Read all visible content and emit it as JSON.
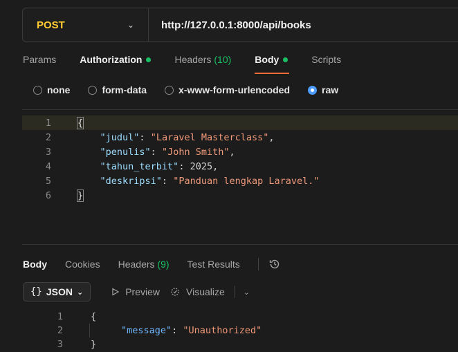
{
  "request": {
    "method": "POST",
    "url": "http://127.0.0.1:8000/api/books"
  },
  "request_tabs": [
    {
      "label": "Params"
    },
    {
      "label": "Authorization",
      "dot": true
    },
    {
      "label": "Headers",
      "count": "(10)"
    },
    {
      "label": "Body",
      "dot": true,
      "active": true
    },
    {
      "label": "Scripts"
    }
  ],
  "body_types": [
    {
      "label": "none",
      "checked": false
    },
    {
      "label": "form-data",
      "checked": false
    },
    {
      "label": "x-www-form-urlencoded",
      "checked": false
    },
    {
      "label": "raw",
      "checked": true
    }
  ],
  "editor": {
    "lines": [
      {
        "n": "1",
        "open": "{"
      },
      {
        "n": "2",
        "key": "\"judul\"",
        "value": "\"Laravel Masterclass\"",
        "trail": ","
      },
      {
        "n": "3",
        "key": "\"penulis\"",
        "value": "\"John Smith\"",
        "trail": ","
      },
      {
        "n": "4",
        "key": "\"tahun_terbit\"",
        "num": "2025",
        "trail": ","
      },
      {
        "n": "5",
        "key": "\"deskripsi\"",
        "value": "\"Panduan lengkap Laravel.\"",
        "trail": ""
      },
      {
        "n": "6",
        "close": "}"
      }
    ]
  },
  "response_tabs": [
    {
      "label": "Body",
      "active": true
    },
    {
      "label": "Cookies"
    },
    {
      "label": "Headers",
      "count": "(9)"
    },
    {
      "label": "Test Results"
    }
  ],
  "response_toolbar": {
    "format_glyph": "{}",
    "format_label": "JSON",
    "preview_label": "Preview",
    "visualize_label": "Visualize"
  },
  "response_body": {
    "lines": [
      {
        "n": "1",
        "text": "{"
      },
      {
        "n": "2",
        "key": "\"message\"",
        "value": "\"Unauthorized\""
      },
      {
        "n": "3",
        "text": "}"
      }
    ]
  },
  "colors": {
    "accent": "#ff6c37",
    "method": "#ffcc33",
    "success": "#18c063",
    "radio": "#4d9cff"
  }
}
